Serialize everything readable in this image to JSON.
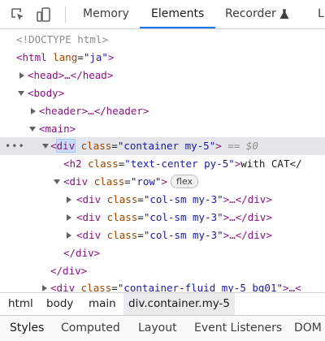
{
  "toolbar": {
    "inspect_icon": "inspect-element-icon",
    "device_icon": "device-toolbar-icon",
    "tabs": [
      {
        "label": "Memory"
      },
      {
        "label": "Elements"
      },
      {
        "label": "Recorder"
      },
      {
        "label": "L"
      }
    ],
    "active_tab": "Elements",
    "recorder_icon": "flask-icon"
  },
  "tree": {
    "doctype": "<!DOCTYPE html>",
    "html_open": "<html",
    "html_attr": "lang",
    "html_attr_val": "\"ja\"",
    "html_close": ">",
    "head": "<head>…</head>",
    "body_open": "<body>",
    "header": "<header>…</header>",
    "main_open": "<main>",
    "selected": {
      "dots": "•••",
      "lt": "<",
      "tag": "div",
      "attr": "class",
      "val": "\"container my-5\"",
      "gt": ">",
      "eq": "== $0"
    },
    "h2": {
      "open": "<h2",
      "attr": "class",
      "val": "\"text-center py-5\"",
      "gt": ">",
      "text": "with CAT</"
    },
    "row": {
      "open": "<div",
      "attr": "class",
      "val": "\"row\"",
      "gt": ">",
      "badge": "flex"
    },
    "cols": [
      {
        "open": "<div",
        "attr": "class",
        "val": "\"col-sm my-3\"",
        "rest": ">…</div>"
      },
      {
        "open": "<div",
        "attr": "class",
        "val": "\"col-sm my-3\"",
        "rest": ">…</div>"
      },
      {
        "open": "<div",
        "attr": "class",
        "val": "\"col-sm my-3\"",
        "rest": ">…</div>"
      }
    ],
    "close_div_1": "</div>",
    "close_div_2": "</div>",
    "fluid": {
      "open": "<div",
      "attr": "class",
      "val": "\"container-fluid my-5 bg01\"",
      "rest": ">…<"
    }
  },
  "breadcrumb": [
    "html",
    "body",
    "main",
    "div.container.my-5"
  ],
  "bottom_tabs": [
    "Styles",
    "Computed",
    "Layout",
    "Event Listeners",
    "DOM"
  ],
  "colors": {
    "accent": "#1a73e8",
    "tag": "#881280",
    "attribute": "#994500",
    "value": "#1a1aa6",
    "selected_row": "#e3e6ea"
  }
}
